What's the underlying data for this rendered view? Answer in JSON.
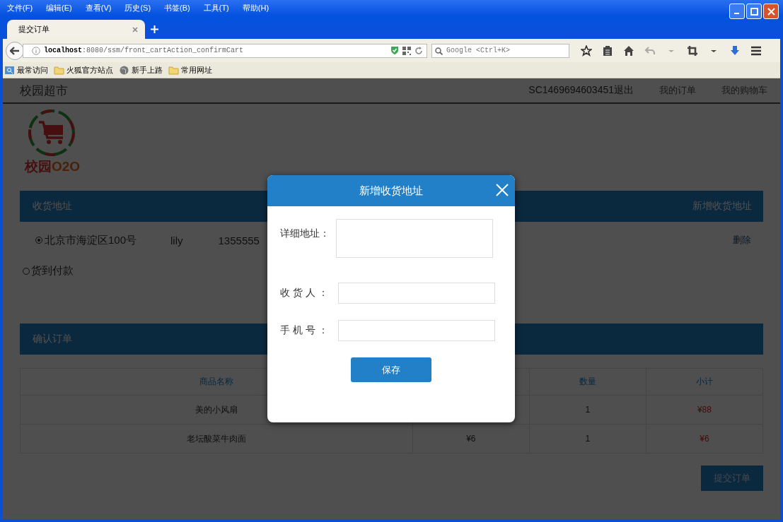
{
  "menu_bar": [
    "文件(F)",
    "编辑(E)",
    "查看(V)",
    "历史(S)",
    "书签(B)",
    "工具(T)",
    "帮助(H)"
  ],
  "tabs": [
    {
      "label": "提交订单",
      "selected": true
    }
  ],
  "address_bar": {
    "url": "**localhost**:8080/ssm/front_cartAction_confirmCart"
  },
  "search": {
    "placeholder": "Google <Ctrl+K>"
  },
  "bookmarks": [
    {
      "label": "最常访问",
      "kind": "smart"
    },
    {
      "label": "火狐官方站点",
      "kind": "folder"
    },
    {
      "label": "新手上路",
      "kind": "globe"
    },
    {
      "label": "常用网址",
      "kind": "folder"
    }
  ],
  "page": {
    "site_title": "校园超市",
    "nav": [
      "SC1469694603451退出",
      "我的订单",
      "我的购物车"
    ],
    "logo_text": {
      "name": "校园",
      "code": "O2O"
    },
    "address_section": {
      "title": "收货地址",
      "action": "新增收货地址",
      "addresses": [
        {
          "address": "北京市海淀区100号",
          "name": "lily",
          "phone": "1355555",
          "selected": true,
          "delete": "删除"
        }
      ]
    },
    "payment": [
      {
        "label": "货到付款",
        "selected": false
      }
    ],
    "order_section": {
      "title": "确认订单",
      "header": {
        "name": "商品名称",
        "quantity": "数量",
        "subtotal": "小计"
      },
      "rows": [
        {
          "name": "美的小风扇",
          "quantity": "1",
          "subtotal": "¥88"
        },
        {
          "name": "老坛酸菜牛肉面",
          "price": "¥6",
          "quantity": "1",
          "subtotal": "¥6"
        }
      ]
    },
    "submit": "提交订单"
  },
  "dialog": {
    "title": "新增收货地址",
    "fields": [
      {
        "label": "详细地址：",
        "kind": "textarea"
      },
      {
        "label": "收 货 人 ：",
        "kind": "input"
      },
      {
        "label": "手 机 号 ：",
        "kind": "input"
      }
    ],
    "save": "保存"
  }
}
